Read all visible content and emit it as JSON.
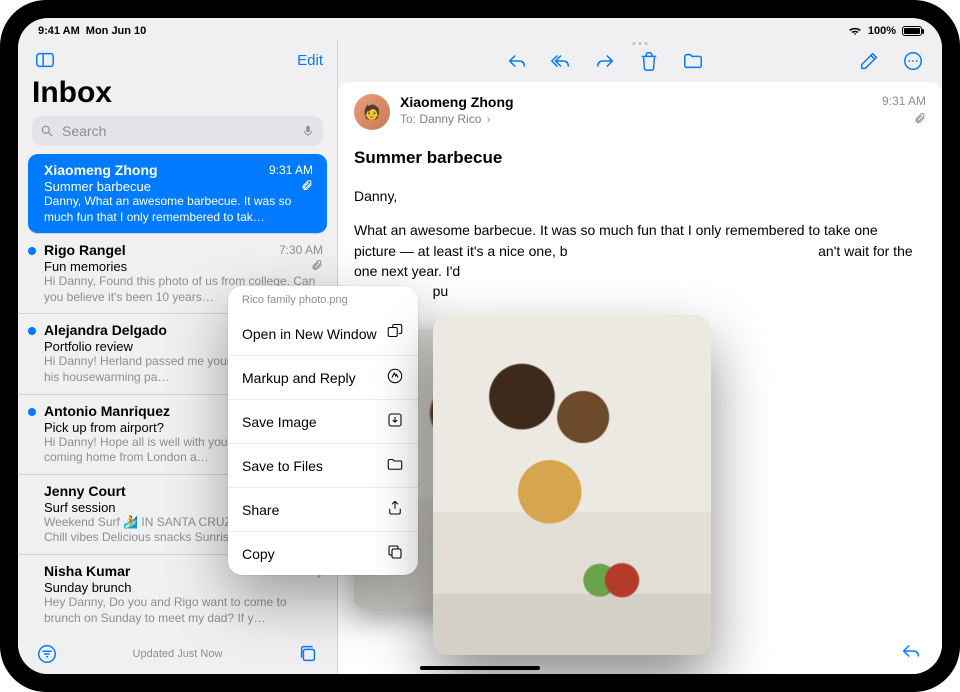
{
  "status": {
    "time": "9:41 AM",
    "date": "Mon Jun 10",
    "battery": "100%"
  },
  "sidebar": {
    "edit": "Edit",
    "title": "Inbox",
    "search_placeholder": "Search",
    "updated": "Updated Just Now"
  },
  "messages": [
    {
      "sender": "Xiaomeng Zhong",
      "time": "9:31 AM",
      "subject": "Summer barbecue",
      "preview": "Danny, What an awesome barbecue. It was so much fun that I only remembered to tak…",
      "attachment": true,
      "selected": true,
      "unread": false
    },
    {
      "sender": "Rigo Rangel",
      "time": "7:30 AM",
      "subject": "Fun memories",
      "preview": "Hi Danny, Found this photo of us from college. Can you believe it's been 10 years…",
      "attachment": true,
      "selected": false,
      "unread": true
    },
    {
      "sender": "Alejandra Delgado",
      "time": "",
      "subject": "Portfolio review",
      "preview": "Hi Danny! Herland passed me your contact info at his housewarming pa…",
      "attachment": false,
      "selected": false,
      "unread": true
    },
    {
      "sender": "Antonio Manriquez",
      "time": "",
      "subject": "Pick up from airport?",
      "preview": "Hi Danny! Hope all is well with you. I'm finally coming home from London a…",
      "attachment": false,
      "selected": false,
      "unread": true
    },
    {
      "sender": "Jenny Court",
      "time": "",
      "subject": "Surf session",
      "preview": "Weekend Surf 🏄 IN SANTA CRUZ Glassy waves Chill vibes Delicious snacks Sunrise…",
      "attachment": false,
      "selected": false,
      "unread": false
    },
    {
      "sender": "Nisha Kumar",
      "time": "Yesterday",
      "subject": "Sunday brunch",
      "preview": "Hey Danny, Do you and Rigo want to come to brunch on Sunday to meet my dad? If y…",
      "attachment": false,
      "selected": false,
      "unread": false
    }
  ],
  "context_menu": {
    "title": "Rico family photo.png",
    "items": [
      {
        "label": "Open in New Window",
        "icon": "new-window"
      },
      {
        "label": "Markup and Reply",
        "icon": "markup"
      },
      {
        "label": "Save Image",
        "icon": "save-down"
      },
      {
        "label": "Save to Files",
        "icon": "folder"
      },
      {
        "label": "Share",
        "icon": "share"
      },
      {
        "label": "Copy",
        "icon": "copy"
      }
    ]
  },
  "message": {
    "from": "Xiaomeng Zhong",
    "to_label": "To:",
    "to": "Danny Rico",
    "time": "9:31 AM",
    "subject": "Summer barbecue",
    "greeting": "Danny,",
    "body_line1": "What an awesome barbecue. It was so much fun that I only remembered to take one",
    "body_line2_a": "picture — at least it's a nice one, b",
    "body_line2_b": "an't wait for the one next year. I'd",
    "body_line3": "pu"
  }
}
